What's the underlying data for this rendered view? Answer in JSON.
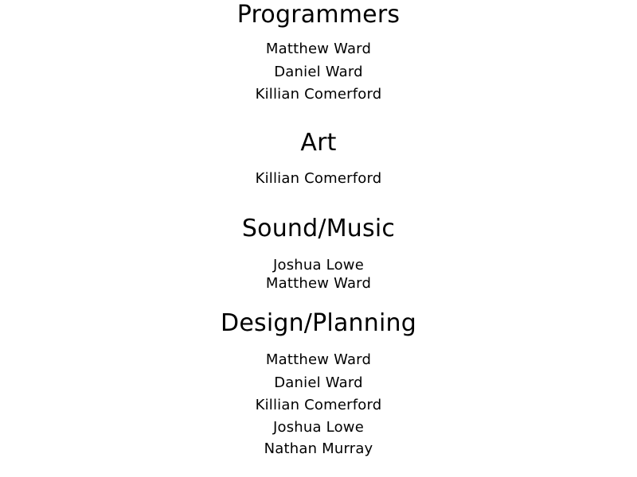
{
  "credits": {
    "sections": [
      {
        "title": "Programmers",
        "names": [
          "Matthew Ward",
          "Daniel Ward",
          "Killian Comerford"
        ]
      },
      {
        "title": "Art",
        "names": [
          "Killian Comerford"
        ]
      },
      {
        "title": "Sound/Music",
        "names": [
          "Joshua Lowe",
          "Matthew Ward"
        ]
      },
      {
        "title": "Design/Planning",
        "names": [
          "Matthew Ward",
          "Daniel Ward",
          "Killian Comerford",
          "Joshua Lowe",
          "Nathan Murray"
        ]
      }
    ]
  }
}
